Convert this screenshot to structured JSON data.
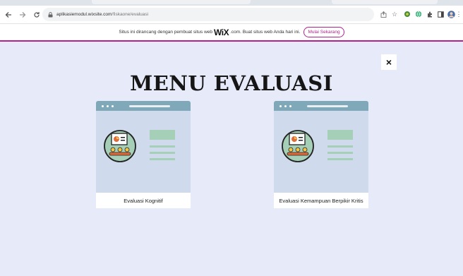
{
  "browser": {
    "url_domain": "aplikasiemodul.wixsite.com",
    "url_path": "/fiskaone/evaluasi"
  },
  "banner": {
    "text": "Situs ini dirancang dengan pembuat situs web",
    "brand": "WiX",
    "text_after": ".com. Buat situs web Anda hari ini.",
    "cta_label": "Mulai Sekarang"
  },
  "page": {
    "close_label": "×",
    "title": "MENU EVALUASI"
  },
  "cards": [
    {
      "label": "Evaluasi Kognitif"
    },
    {
      "label": "Evaluasi Kemampuan Berpikir Kritis"
    }
  ],
  "colors": {
    "accent": "#b0238f",
    "page_bg": "#e6eaf9",
    "card_bg": "#cfdbec",
    "card_bar": "#7fa8b8",
    "illustration_green": "#a6cfb8"
  }
}
